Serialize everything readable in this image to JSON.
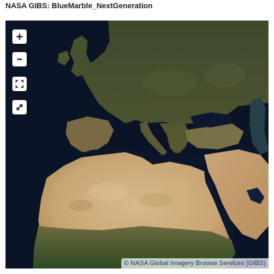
{
  "page": {
    "title": "NASA GIBS: BlueMarble_NextGeneration"
  },
  "map": {
    "layer": "BlueMarble_NextGeneration",
    "colors": {
      "ocean": "#0b1327",
      "forest": "#3d4a2a",
      "steppe": "#5a5a3a",
      "desert": "#c9a878",
      "savanna": "#3f5a2a",
      "caspian": "#2a4a48"
    },
    "controls": [
      {
        "name": "zoom-in",
        "icon": "plus-icon"
      },
      {
        "name": "zoom-out",
        "icon": "minus-icon"
      },
      {
        "name": "zoom-to-extent",
        "icon": "expand-corners-icon"
      },
      {
        "name": "fullscreen",
        "icon": "diagonal-arrows-icon"
      }
    ],
    "attribution": "© NASA Global Imagery Browse Services (GIBS)"
  }
}
